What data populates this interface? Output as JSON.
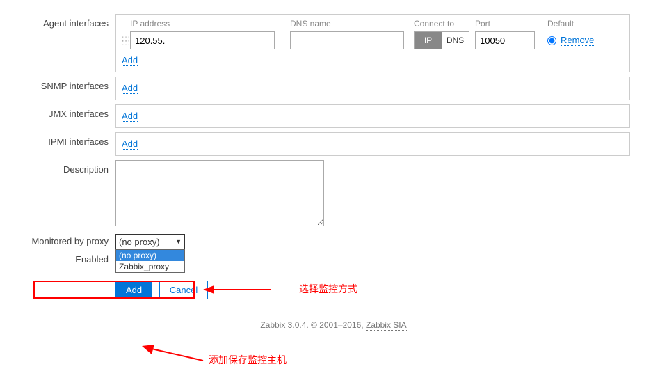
{
  "labels": {
    "agent_interfaces": "Agent interfaces",
    "snmp_interfaces": "SNMP interfaces",
    "jmx_interfaces": "JMX interfaces",
    "ipmi_interfaces": "IPMI interfaces",
    "description": "Description",
    "monitored_by_proxy": "Monitored by proxy",
    "enabled": "Enabled"
  },
  "interface_headers": {
    "ip": "IP address",
    "dns": "DNS name",
    "connect": "Connect to",
    "port": "Port",
    "default": "Default"
  },
  "agent_interface": {
    "ip": "120.55.",
    "dns": "",
    "port": "10050"
  },
  "connect_toggle": {
    "ip": "IP",
    "dns": "DNS"
  },
  "links": {
    "remove": "Remove",
    "add": "Add"
  },
  "proxy_select": {
    "value": "(no proxy)",
    "options": {
      "no_proxy": "(no proxy)",
      "zabbix_proxy": "Zabbix_proxy"
    }
  },
  "buttons": {
    "add": "Add",
    "cancel": "Cancel"
  },
  "annotations": {
    "select_method": "选择监控方式",
    "save_host": "添加保存监控主机"
  },
  "footer": {
    "prefix": "Zabbix 3.0.4. © 2001–2016, ",
    "link": "Zabbix SIA"
  }
}
